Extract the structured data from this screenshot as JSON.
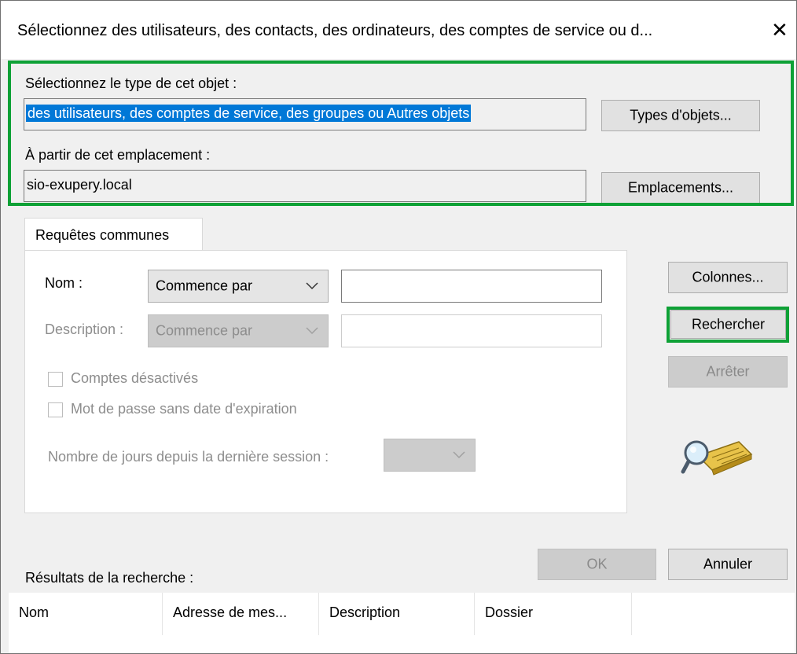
{
  "window": {
    "title": "Sélectionnez des utilisateurs, des contacts, des ordinateurs, des comptes de service ou d...",
    "close_icon": "close-icon"
  },
  "object_type": {
    "label": "Sélectionnez le type de cet objet :",
    "value": "des utilisateurs, des comptes de service, des groupes ou Autres objets",
    "button": "Types d'objets..."
  },
  "location": {
    "label": "À partir de cet emplacement :",
    "value": "sio-exupery.local",
    "button": "Emplacements..."
  },
  "tabs": [
    {
      "label": "Requêtes communes"
    }
  ],
  "query": {
    "name_label": "Nom :",
    "name_mode": "Commence par",
    "name_value": "",
    "description_label": "Description :",
    "description_mode": "Commence par",
    "description_value": "",
    "disabled_accounts_label": "Comptes désactivés",
    "no_expiry_label": "Mot de passe sans date d'expiration",
    "days_label": "Nombre de jours depuis la dernière session :",
    "days_value": ""
  },
  "side_buttons": {
    "columns": "Colonnes...",
    "search": "Rechercher",
    "stop": "Arrêter",
    "search_icon": "find-flashlight-icon"
  },
  "dialog_buttons": {
    "ok": "OK",
    "cancel": "Annuler"
  },
  "results": {
    "label": "Résultats de la recherche :",
    "columns": [
      "Nom",
      "Adresse de mes...",
      "Description",
      "Dossier"
    ],
    "rows": []
  },
  "colors": {
    "highlight_border": "#0ea136",
    "selection": "#0078d7"
  }
}
